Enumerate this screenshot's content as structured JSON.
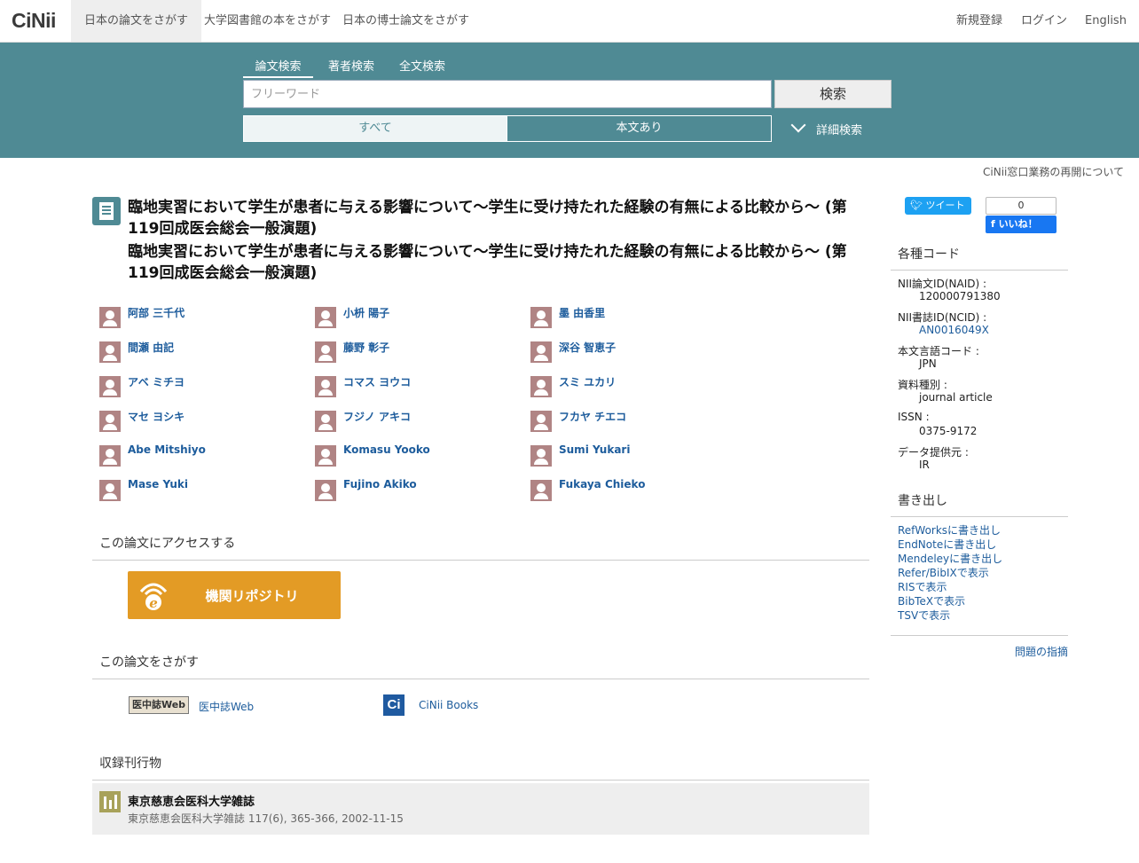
{
  "nav": {
    "logo": "CiNii",
    "tabs": [
      "日本の論文をさがす",
      "大学図書館の本をさがす",
      "日本の博士論文をさがす"
    ],
    "right": [
      "新規登録",
      "ログイン",
      "English"
    ]
  },
  "search": {
    "tabs": [
      "論文検索",
      "著者検索",
      "全文検索"
    ],
    "placeholder": "フリーワード",
    "button": "検索",
    "filters": [
      "すべて",
      "本文あり"
    ],
    "advanced": "詳細検索"
  },
  "notice": "CiNii窓口業務の再開について",
  "article": {
    "title_ja": "臨地実習において学生が患者に与える影響について～学生に受け持たれた経験の有無による比較から～ (第119回成医会総会一般演題)",
    "title_alt": "臨地実習において学生が患者に与える影響について～学生に受け持たれた経験の有無による比較から～ (第119回成医会総会一般演題)",
    "authors": [
      [
        "阿部 三千代",
        "小枡 陽子",
        "墨 由香里"
      ],
      [
        "間瀬 由記",
        "藤野 彰子",
        "深谷 智恵子"
      ],
      [
        "アベ ミチヨ",
        "コマス ヨウコ",
        "スミ ユカリ"
      ],
      [
        "マセ ヨシキ",
        "フジノ アキコ",
        "フカヤ チエコ"
      ],
      [
        "Abe Mitshiyo",
        "Komasu Yooko",
        "Sumi Yukari"
      ],
      [
        "Mase Yuki",
        "Fujino Akiko",
        "Fukaya Chieko"
      ]
    ]
  },
  "access": {
    "heading": "この論文にアクセスする",
    "repository_label": "機関リポジトリ"
  },
  "find": {
    "heading": "この論文をさがす",
    "ichushi_logo": "医中誌Web",
    "ichushi_link": "医中誌Web",
    "cinii_logo": "Ci",
    "cinii_books": "CiNii Books"
  },
  "journal": {
    "heading": "収録刊行物",
    "name": "東京慈恵会医科大学雑誌",
    "citation": "東京慈恵会医科大学雑誌 117(6), 365-366, 2002-11-15"
  },
  "social": {
    "tweet": "ツイート",
    "like_count": "0",
    "like_label": "いいね！"
  },
  "codes": {
    "heading": "各種コード",
    "items": [
      {
        "label": "NII論文ID(NAID) :",
        "value": "120000791380"
      },
      {
        "label": "NII書誌ID(NCID) :",
        "value": "AN0016049X"
      },
      {
        "label": "本文言語コード :",
        "value": "JPN"
      },
      {
        "label": "資料種別 :",
        "value": "journal article"
      },
      {
        "label": "ISSN :",
        "value": "0375-9172"
      },
      {
        "label": "データ提供元 :",
        "value": "IR"
      }
    ]
  },
  "export": {
    "heading": "書き出し",
    "items": [
      "RefWorksに書き出し",
      "EndNoteに書き出し",
      "Mendeleyに書き出し",
      "Refer/BibIXで表示",
      "RISで表示",
      "BibTeXで表示",
      "TSVで表示"
    ]
  },
  "report": "問題の指摘",
  "colors": {
    "band": "#4f8a94",
    "link": "#1d5c9c",
    "repo": "#e39b25"
  }
}
